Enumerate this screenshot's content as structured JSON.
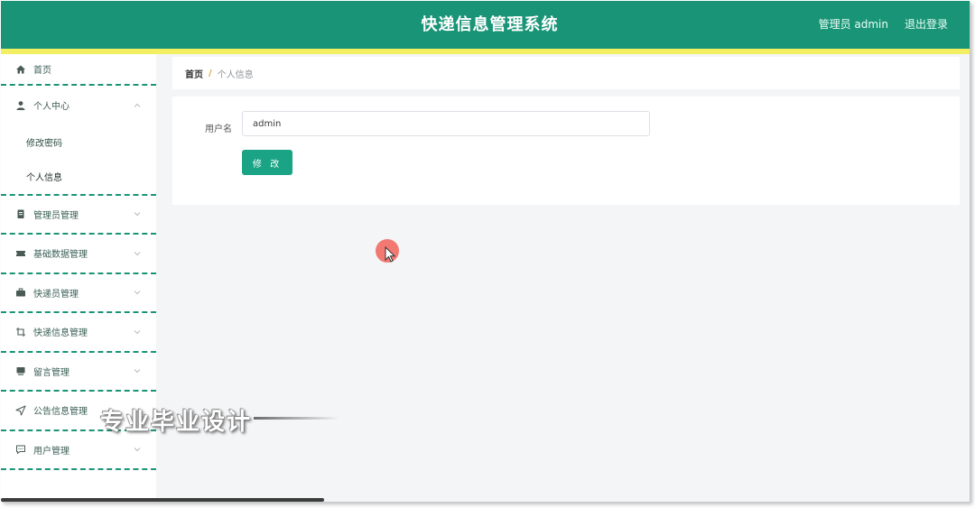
{
  "header": {
    "app_title": "快递信息管理系统",
    "user_label": "管理员 admin",
    "logout_label": "退出登录",
    "color": "#1a9477",
    "stripe_color": "#f3ef62"
  },
  "sidebar": {
    "items": [
      {
        "label": "首页",
        "icon": "home-icon"
      },
      {
        "label": "个人中心",
        "icon": "user-icon",
        "expanded": true,
        "children": [
          {
            "label": "修改密码"
          },
          {
            "label": "个人信息"
          }
        ]
      },
      {
        "label": "管理员管理",
        "icon": "clipboard-icon"
      },
      {
        "label": "基础数据管理",
        "icon": "ticket-icon"
      },
      {
        "label": "快递员管理",
        "icon": "briefcase-icon"
      },
      {
        "label": "快递信息管理",
        "icon": "crop-icon"
      },
      {
        "label": "留言管理",
        "icon": "monitor-icon"
      },
      {
        "label": "公告信息管理",
        "icon": "navigation-icon"
      },
      {
        "label": "用户管理",
        "icon": "chat-icon"
      }
    ]
  },
  "breadcrumb": {
    "home": "首页",
    "separator": "/",
    "current": "个人信息"
  },
  "form": {
    "username_label": "用户名",
    "username_value": "admin",
    "submit_label": "修 改",
    "button_color": "#1aa384"
  },
  "watermark": {
    "text": "专业毕业设计"
  }
}
